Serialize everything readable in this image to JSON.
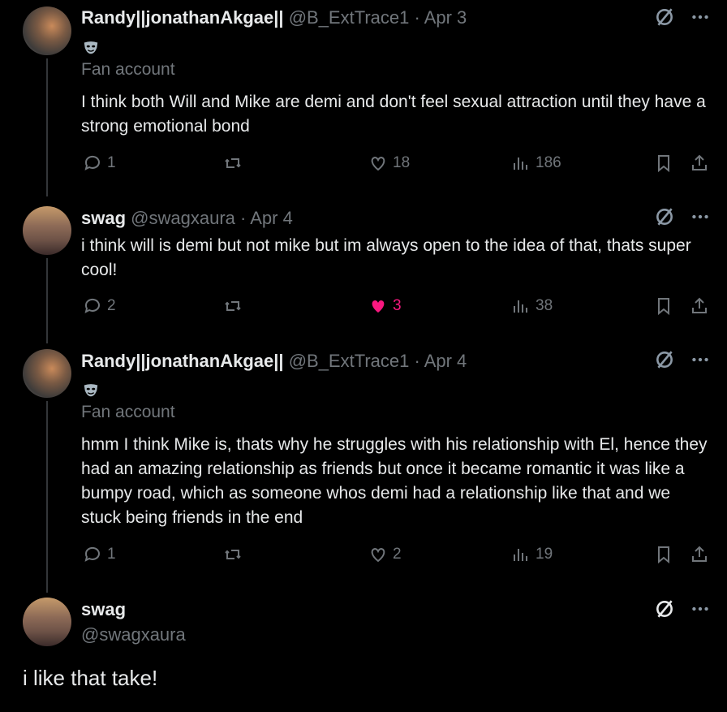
{
  "tweets": [
    {
      "name": "Randy||jonathanAkgae||",
      "handle": "@B_ExtTrace1 · Apr 3",
      "fan_label": "Fan account",
      "text": "I think both Will and Mike are demi and don't feel sexual attraction until they have a strong emotional bond",
      "replies": "1",
      "likes": "18",
      "views": "186"
    },
    {
      "name": "swag",
      "handle": "@swagxaura · Apr 4",
      "text": "i think will is demi but not mike but im always open to the idea of that, thats super cool!",
      "replies": "2",
      "likes": "3",
      "views": "38",
      "liked_color": "#f91880"
    },
    {
      "name": "Randy||jonathanAkgae||",
      "handle": "@B_ExtTrace1 · Apr 4",
      "fan_label": "Fan account",
      "text": "hmm I think Mike is, thats why he struggles with his relationship with El, hence they had an amazing relationship as friends but once it became romantic it was like a bumpy road, which as someone whos demi had a relationship like that and we stuck being friends in the end",
      "replies": "1",
      "likes": "2",
      "views": "19"
    }
  ],
  "focused": {
    "name": "swag",
    "handle": "@swagxaura",
    "text": "i like that take!"
  },
  "icons": [
    "reply-icon",
    "retweet-icon",
    "like-icon",
    "views-icon",
    "bookmark-icon",
    "share-icon",
    "grok-icon",
    "more-icon",
    "mask-badge-icon"
  ]
}
